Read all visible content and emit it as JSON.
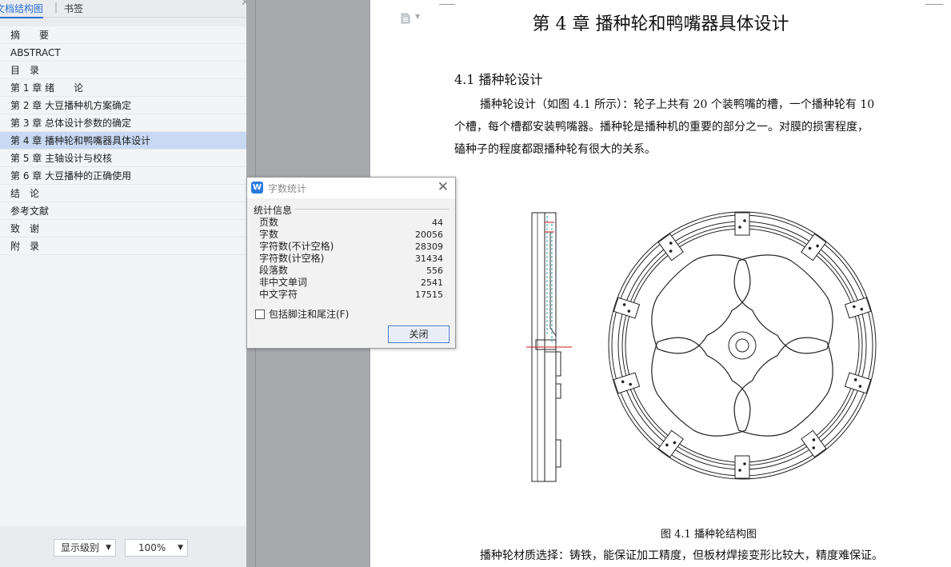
{
  "nav": {
    "tabs": [
      {
        "label": "文档结构图"
      },
      {
        "label": "书签"
      }
    ],
    "outline": [
      {
        "label": "摘　　要"
      },
      {
        "label": "ABSTRACT"
      },
      {
        "label": "目　录"
      },
      {
        "label": "第 1 章  绪　　论"
      },
      {
        "label": "第 2 章  大豆播种机方案确定"
      },
      {
        "label": "第 3 章  总体设计参数的确定"
      },
      {
        "label": "第 4 章  播种轮和鸭嘴器具体设计"
      },
      {
        "label": "第 5 章  主轴设计与校核"
      },
      {
        "label": "第 6 章  大豆播种的正确使用"
      },
      {
        "label": "结　论"
      },
      {
        "label": "参考文献"
      },
      {
        "label": "致　谢"
      },
      {
        "label": "附　录"
      }
    ],
    "active_index": 6,
    "level_select": "显示级别",
    "zoom_select": "100%"
  },
  "document": {
    "chapter_title": "第 4 章  播种轮和鸭嘴器具体设计",
    "section_title": "4.1  播种轮设计",
    "paragraph1_line1": "播种轮设计（如图 4.1 所示）：轮子上共有 20 个装鸭嘴的槽，一个播种轮有 10",
    "paragraph1_line2": "个槽，每个槽都安装鸭嘴器。播种轮是播种机的重要的部分之一。对膜的损害程度，",
    "paragraph1_line3": "磕种子的程度都跟播种轮有很大的关系。",
    "figure_caption": "图 4.1  播种轮结构图",
    "paragraph2": "播种轮材质选择：铸铁，能保证加工精度，但板材焊接变形比较大，精度难保证。"
  },
  "dialog": {
    "title": "字数统计",
    "heading": "统计信息",
    "stats": [
      {
        "label": "页数",
        "value": "44"
      },
      {
        "label": "字数",
        "value": "20056"
      },
      {
        "label": "字符数(不计空格)",
        "value": "28309"
      },
      {
        "label": "字符数(计空格)",
        "value": "31434"
      },
      {
        "label": "段落数",
        "value": "556"
      },
      {
        "label": "非中文单词",
        "value": "2541"
      },
      {
        "label": "中文字符",
        "value": "17515"
      }
    ],
    "footnote_label": "包括脚注和尾注(F)",
    "footnote_checked": false,
    "close_button": "关闭"
  },
  "colors": {
    "accent": "#2a6fd6",
    "active_outline_bg": "#c7d9f3",
    "workspace_gray": "#a8aaad"
  },
  "icons": {
    "app_logo": "wps-writer-icon",
    "dialog_close": "close-icon",
    "doc_icon": "document-icon"
  }
}
